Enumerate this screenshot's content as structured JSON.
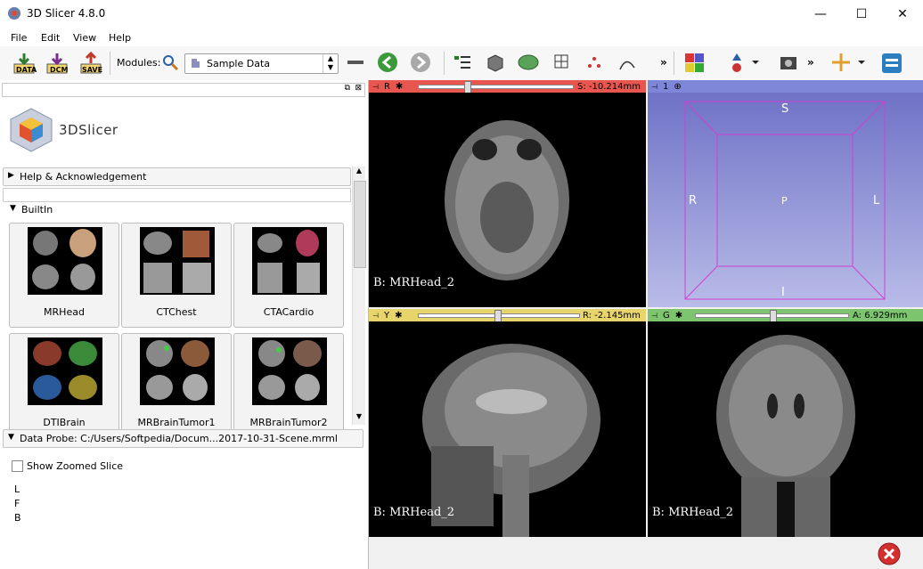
{
  "window": {
    "title": "3D Slicer 4.8.0",
    "minimize": "—",
    "maximize": "☐",
    "close": "✕"
  },
  "menu": [
    "File",
    "Edit",
    "View",
    "Help"
  ],
  "toolbar": {
    "data_label": "DATA",
    "dcm_label": "DCM",
    "save_label": "SAVE",
    "modules_label": "Modules:",
    "module_value": "Sample Data",
    "more": "»"
  },
  "left_panel": {
    "logo_text": "3DSlicer",
    "help_section": "Help & Acknowledgement",
    "builtin_section": "BuiltIn",
    "samples": [
      "MRHead",
      "CTChest",
      "CTACardio",
      "DTIBrain",
      "MRBrainTumor1",
      "MRBrainTumor2"
    ],
    "data_probe": "Data Probe: C:/Users/Softpedia/Docum...2017-10-31-Scene.mrml",
    "show_zoomed": "Show Zoomed Slice",
    "probe_lines": [
      "L",
      "F",
      "B"
    ]
  },
  "views": {
    "red": {
      "letter": "R",
      "offset": "S: -10.214mm",
      "label": "B: MRHead_2",
      "slider": 0.31,
      "color": "#e8574f"
    },
    "threed": {
      "num": "1",
      "top": "S",
      "left": "R",
      "center": "P",
      "right": "L",
      "bottom": "I",
      "color": "#7e86d8"
    },
    "yellow": {
      "letter": "Y",
      "offset": "R: -2.145mm",
      "label": "B: MRHead_2",
      "slider": 0.49,
      "color": "#e7d56b"
    },
    "green": {
      "letter": "G",
      "offset": "A: 6.929mm",
      "label": "B: MRHead_2",
      "slider": 0.5,
      "color": "#7dc46e"
    }
  }
}
